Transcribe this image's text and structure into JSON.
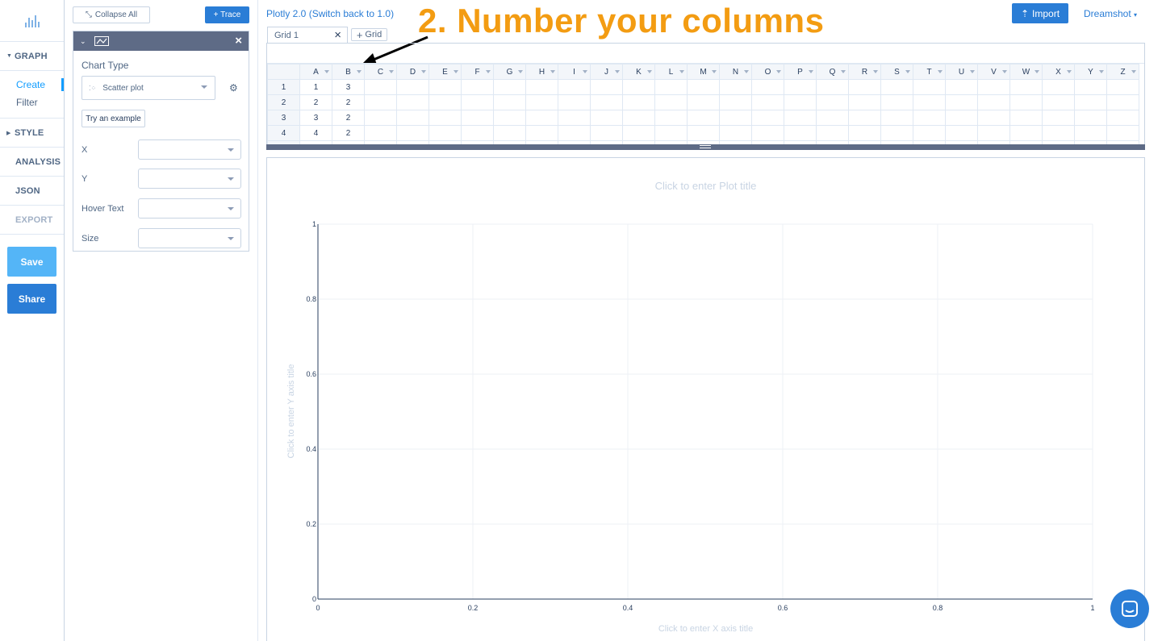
{
  "nav": {
    "sections": [
      "GRAPH",
      "STYLE",
      "ANALYSIS",
      "JSON",
      "EXPORT"
    ],
    "graph_sub": [
      "Create",
      "Filter"
    ],
    "save_label": "Save",
    "share_label": "Share"
  },
  "panel": {
    "collapse_label": "Collapse All",
    "add_trace_label": "+ Trace",
    "chart_type_label": "Chart Type",
    "chart_type_value": "Scatter plot",
    "try_example_label": "Try an example",
    "fields": [
      "X",
      "Y",
      "Hover Text",
      "Size"
    ]
  },
  "topbar": {
    "title": "Plotly 2.0 (Switch back to 1.0)",
    "import_label": "Import",
    "user_label": "Dreamshot"
  },
  "annotation": "2. Number your columns",
  "grid": {
    "tab_label": "Grid 1",
    "add_grid_label": "Grid",
    "columns": [
      "A",
      "B",
      "C",
      "D",
      "E",
      "F",
      "G",
      "H",
      "I",
      "J",
      "K",
      "L",
      "M",
      "N",
      "O",
      "P",
      "Q",
      "R",
      "S",
      "T",
      "U",
      "V",
      "W",
      "X",
      "Y",
      "Z"
    ],
    "rows": [
      {
        "n": "1",
        "a": "1",
        "b": "3"
      },
      {
        "n": "2",
        "a": "2",
        "b": "2"
      },
      {
        "n": "3",
        "a": "3",
        "b": "2"
      },
      {
        "n": "4",
        "a": "4",
        "b": "2"
      }
    ]
  },
  "plot": {
    "title_placeholder": "Click to enter Plot title",
    "x_title_placeholder": "Click to enter X axis title",
    "y_title_placeholder": "Click to enter Y axis title",
    "x_ticks": [
      "0",
      "0.2",
      "0.4",
      "0.6",
      "0.8",
      "1"
    ],
    "y_ticks": [
      "0",
      "0.2",
      "0.4",
      "0.6",
      "0.8",
      "1"
    ]
  },
  "colors": {
    "accent": "#2a7dd6",
    "annotation": "#f39c12"
  }
}
